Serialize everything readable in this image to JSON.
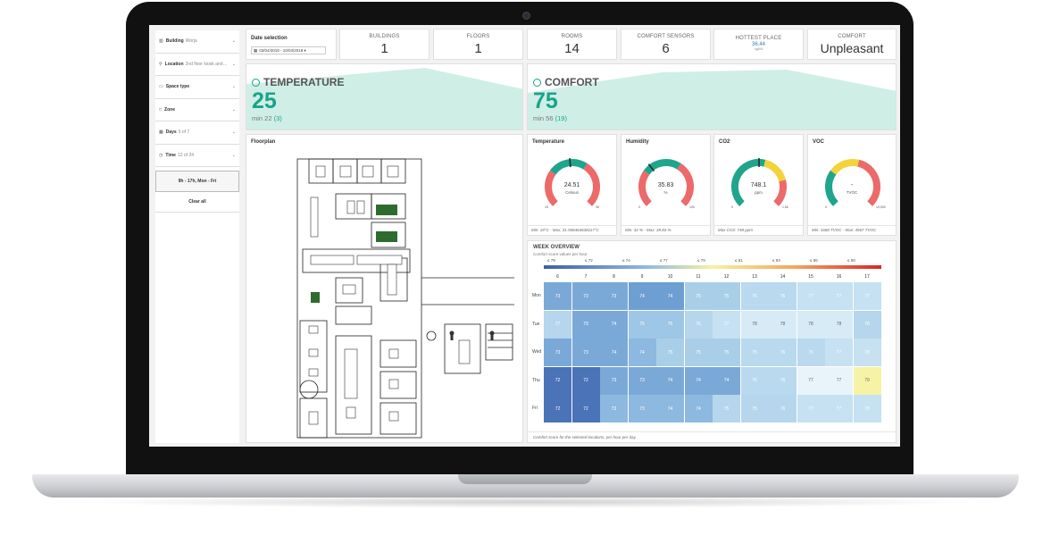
{
  "sidebar": {
    "filters": [
      {
        "label": "Building",
        "sub": "Worja",
        "icon": "building-icon"
      },
      {
        "label": "Location",
        "sub": "2nd floor kiosk and…",
        "icon": "location-pin-icon"
      },
      {
        "label": "Space type",
        "sub": "",
        "icon": "monitor-icon"
      },
      {
        "label": "Zone",
        "sub": "",
        "icon": "square-icon"
      },
      {
        "label": "Days",
        "sub": "5 of 7",
        "icon": "calendar-icon"
      },
      {
        "label": "Time",
        "sub": "12 of 24",
        "icon": "clock-icon"
      }
    ],
    "time_button": "9h - 17h, Mon - Fri",
    "clear_all": "Clear all"
  },
  "date": {
    "title": "Date selection",
    "range": "03/04/2018 - 10/04/2018 ▾"
  },
  "kpis": [
    {
      "label": "BUILDINGS",
      "value": "1"
    },
    {
      "label": "FLOORS",
      "value": "1"
    },
    {
      "label": "ROOMS",
      "value": "14"
    },
    {
      "label": "COMFORT SENSORS",
      "value": "6"
    }
  ],
  "hottest": {
    "label": "HOTTEST PLACE",
    "value": "36.44",
    "unit": "ng/m3"
  },
  "comfort_kpi": {
    "label": "COMFORT",
    "value": "Unpleasant"
  },
  "temperature_panel": {
    "title": "TEMPERATURE",
    "value": "25",
    "min_prefix": "min 22",
    "min_paren": "(3)"
  },
  "comfort_panel": {
    "title": "COMFORT",
    "value": "75",
    "min_prefix": "min 56",
    "min_paren": "(19)"
  },
  "floorplan": {
    "title": "Floorplan"
  },
  "gauges": [
    {
      "title": "Temperature",
      "value": "24.51",
      "unit": "Celsius",
      "min": "15",
      "max": "35",
      "level": 0.48,
      "foot": "Min: 19°C - Max: 31.558464638117°C"
    },
    {
      "title": "Humidity",
      "value": "35.83",
      "unit": "%",
      "min": "0",
      "max": "100",
      "level": 0.36,
      "foot": "Min: 32 % - Max: 39.83 %"
    },
    {
      "title": "CO2",
      "value": "748.1",
      "unit": "ppm",
      "min": "0",
      "max": "1.5k",
      "level": 0.5,
      "foot": "Max CO2: 748 ppm"
    },
    {
      "title": "VOC",
      "value": "-",
      "unit": "TVOC",
      "min": "0",
      "max": "10,000",
      "level": 0.0,
      "foot": "Min: 1668 TVOC - Max: 4567 TVOC"
    }
  ],
  "week": {
    "title": "WEEK OVERVIEW",
    "subtitle": "Comfort score values per hour",
    "legend": [
      "≤ 79",
      "≤ 72",
      "≤ 74",
      "≤ 77",
      "≤ 79",
      "≤ 81",
      "≤ 83",
      "≤ 86",
      "≤ 88"
    ],
    "hours": [
      "6",
      "7",
      "8",
      "9",
      "10",
      "11",
      "12",
      "13",
      "14",
      "15",
      "16",
      "17"
    ],
    "days": [
      "Mon",
      "Tue",
      "Wed",
      "Thu",
      "Fri"
    ],
    "values": [
      [
        "73",
        "73",
        "73",
        "74",
        "74",
        "75",
        "75",
        "76",
        "76",
        "77",
        "77",
        "77"
      ],
      [
        "77",
        "73",
        "74",
        "75",
        "75",
        "76",
        "77",
        "78",
        "78",
        "78",
        "78",
        "78"
      ],
      [
        "73",
        "73",
        "74",
        "74",
        "75",
        "75",
        "75",
        "75",
        "76",
        "76",
        "77",
        "78"
      ],
      [
        "72",
        "72",
        "73",
        "73",
        "74",
        "74",
        "74",
        "76",
        "76",
        "77",
        "77",
        "79"
      ],
      [
        "72",
        "72",
        "73",
        "73",
        "74",
        "74",
        "75",
        "75",
        "76",
        "77",
        "77",
        "78"
      ]
    ],
    "colors": [
      [
        "#7aa9d8",
        "#7aa9d8",
        "#7aa9d8",
        "#6d9fd2",
        "#6d9fd2",
        "#a9cfe8",
        "#a9cfe8",
        "#b8d9ee",
        "#b8d9ee",
        "#c6e1f1",
        "#c6e1f1",
        "#c6e1f1"
      ],
      [
        "#b5d6ec",
        "#7aa9d8",
        "#7aa9d8",
        "#9ec6e6",
        "#9ec6e6",
        "#b5d6ec",
        "#c6e1f1",
        "#d6ebf6",
        "#d6ebf6",
        "#d6ebf6",
        "#d6ebf6",
        "#b5d6ec"
      ],
      [
        "#7aa9d8",
        "#7aa9d8",
        "#7aa9d8",
        "#8db8e0",
        "#a9cfe8",
        "#a9cfe8",
        "#a9cfe8",
        "#b8d9ee",
        "#b8d9ee",
        "#b8d9ee",
        "#c6e1f1",
        "#c6e1f1"
      ],
      [
        "#4a73b8",
        "#4a73b8",
        "#7aa9d8",
        "#7aa9d8",
        "#7aa9d8",
        "#7aa9d8",
        "#7aa9d8",
        "#b8d9ee",
        "#b8d9ee",
        "#e9f3fa",
        "#e9f3fa",
        "#f7f3a6"
      ],
      [
        "#4a73b8",
        "#4a73b8",
        "#8db8e0",
        "#8db8e0",
        "#8db8e0",
        "#8db8e0",
        "#b5d6ec",
        "#b5d6ec",
        "#b5d6ec",
        "#c6e1f1",
        "#c6e1f1",
        "#c6e1f1"
      ]
    ],
    "foot": "Comfort score for the selected locations, per hour per day."
  }
}
